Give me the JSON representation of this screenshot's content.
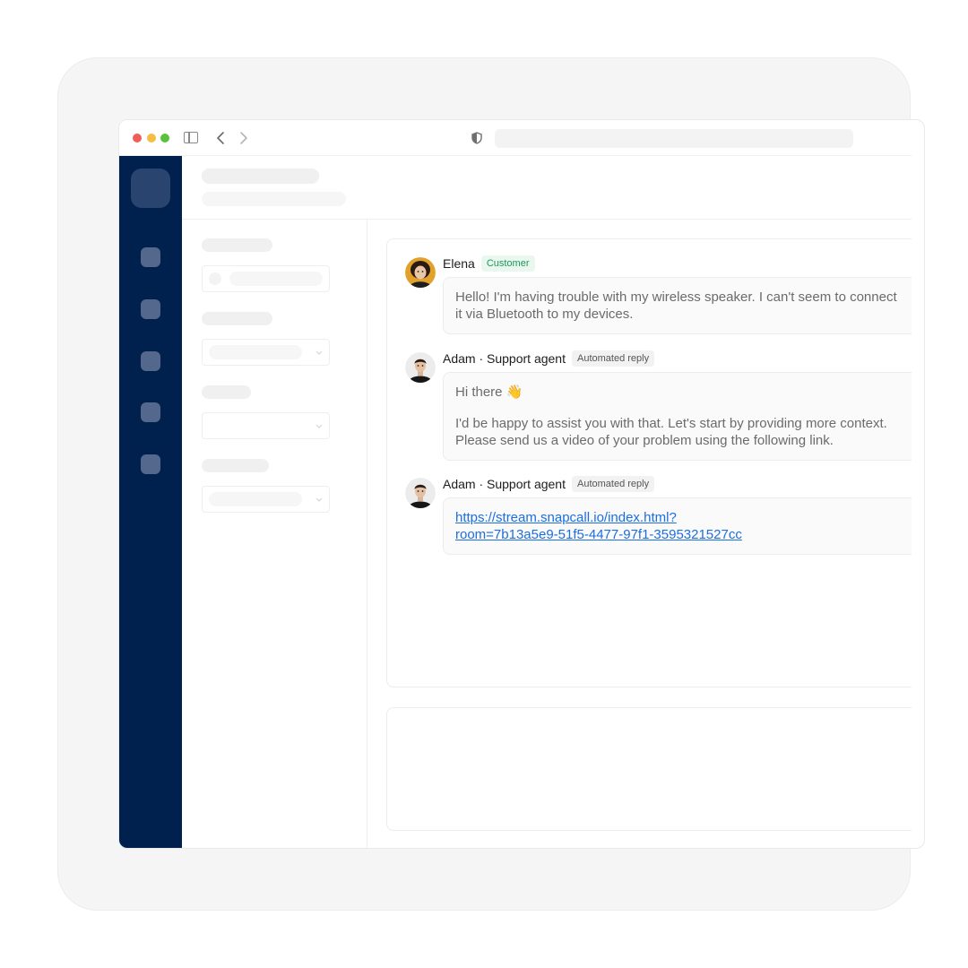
{
  "conversation": {
    "messages": [
      {
        "author": "Elena",
        "badge": "Customer",
        "lines": [
          "Hello! I'm having trouble with my wireless speaker. I can't seem to connect",
          "it via Bluetooth to my devices."
        ]
      },
      {
        "author": "Adam · Support agent",
        "badge": "Automated reply",
        "greeting": "Hi there 👋",
        "lines": [
          "I'd be happy to assist you with that. Let's start by providing more context.",
          "Please send us a video of your problem using the following link."
        ]
      },
      {
        "author": "Adam · Support agent",
        "badge": "Automated reply",
        "link_lines": [
          "https://stream.snapcall.io/index.html?",
          "room=7b13a5e9-51f5-4477-97f1-3595321527cc"
        ]
      }
    ]
  },
  "colors": {
    "rail": "#00214e",
    "link": "#1b6fe0",
    "customer_badge": "#1a9a57"
  },
  "icons": [
    "sidebar-toggle-icon",
    "chevron-left-icon",
    "chevron-right-icon",
    "shield-icon",
    "chevron-down-icon"
  ]
}
